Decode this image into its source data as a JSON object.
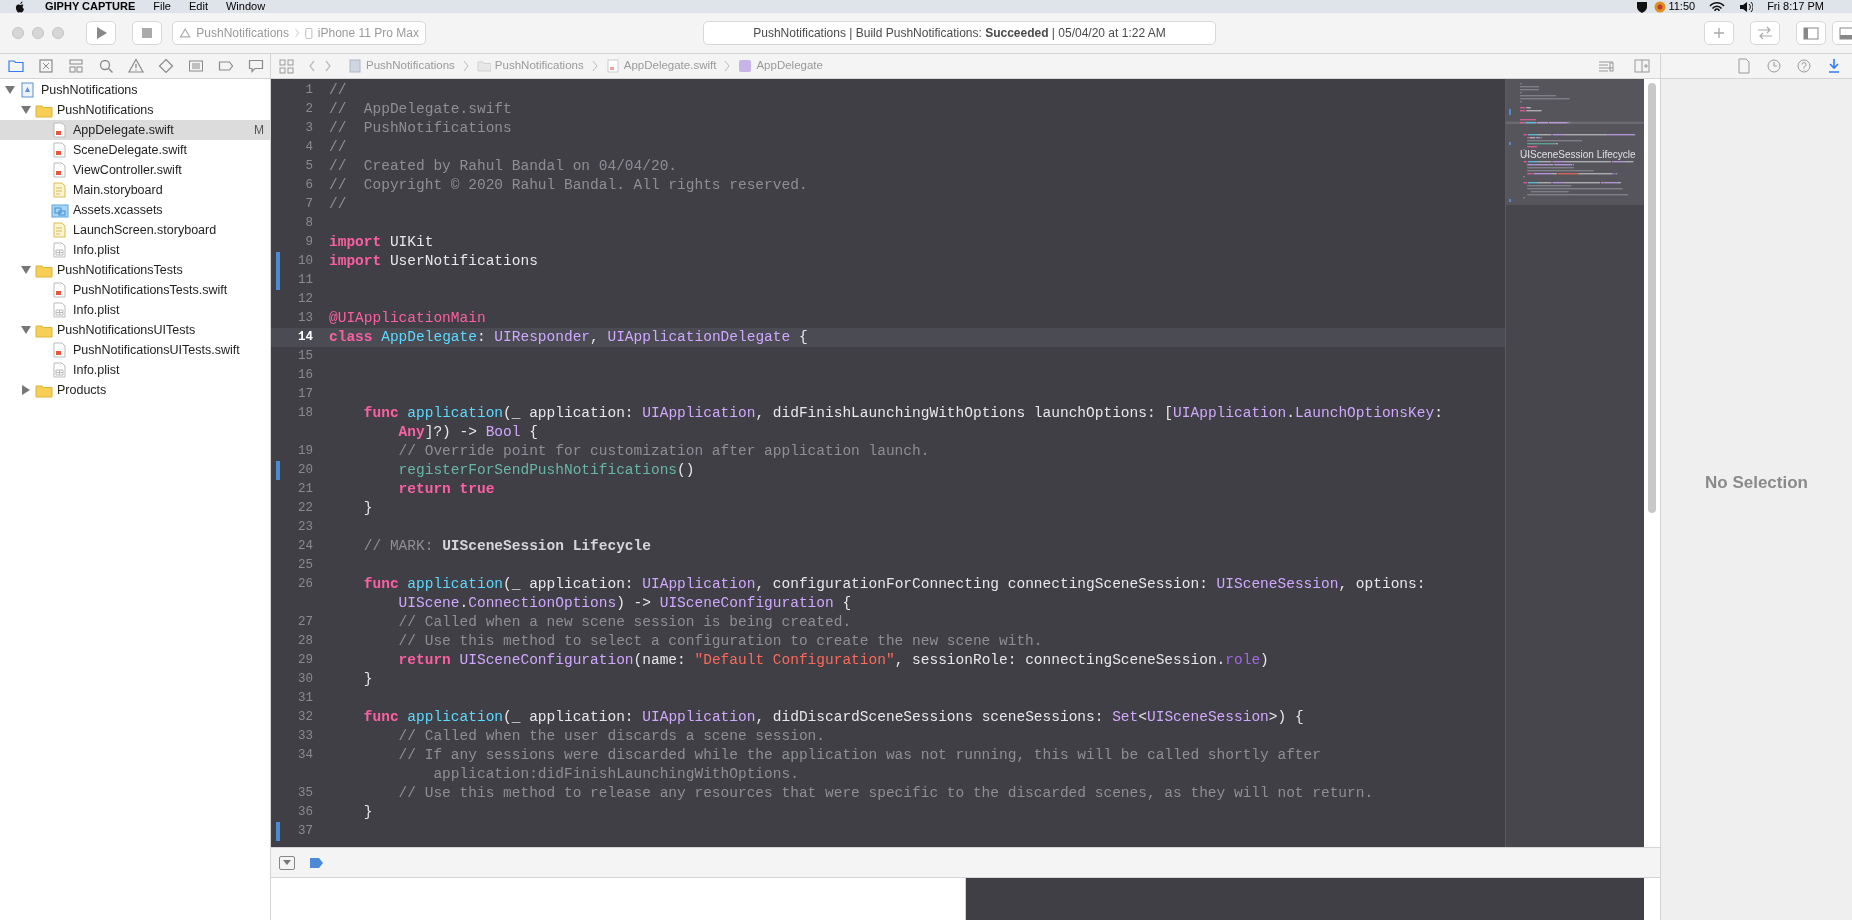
{
  "menubar": {
    "app": "GIPHY CAPTURE",
    "menus": [
      "File",
      "Edit",
      "Window"
    ],
    "status_time": "11:50",
    "datetime": "Fri 8:17 PM"
  },
  "toolbar": {
    "scheme": "PushNotifications",
    "device": "iPhone 11 Pro Max",
    "status": "PushNotifications | Build PushNotifications: **Succeeded** | 05/04/20 at 1:22 AM"
  },
  "navigator_tabs": [
    {
      "kind": "project",
      "selected": true
    },
    {
      "kind": "source_control",
      "selected": false
    },
    {
      "kind": "symbols",
      "selected": false
    },
    {
      "kind": "find",
      "selected": false
    },
    {
      "kind": "issues",
      "selected": false
    },
    {
      "kind": "tests",
      "selected": false
    },
    {
      "kind": "debug",
      "selected": false
    },
    {
      "kind": "breakpoints",
      "selected": false
    },
    {
      "kind": "reports",
      "selected": false
    }
  ],
  "jump_bar": [
    {
      "kind": "project",
      "label": "PushNotifications"
    },
    {
      "kind": "folder",
      "label": "PushNotifications"
    },
    {
      "kind": "swift",
      "label": "AppDelegate.swift"
    },
    {
      "kind": "class",
      "label": "AppDelegate"
    }
  ],
  "inspector_tabs": [
    {
      "kind": "file",
      "selected": false
    },
    {
      "kind": "history",
      "selected": false
    },
    {
      "kind": "help",
      "selected": false
    },
    {
      "kind": "attributes",
      "selected": true
    }
  ],
  "navigator": {
    "tree": [
      {
        "label": "PushNotifications",
        "kind": "project",
        "expanded": true,
        "selected": false,
        "children": [
          {
            "label": "PushNotifications",
            "kind": "folder",
            "expanded": true,
            "selected": false,
            "children": [
              {
                "label": "AppDelegate.swift",
                "kind": "swift",
                "selected": true,
                "badge": "M"
              },
              {
                "label": "SceneDelegate.swift",
                "kind": "swift",
                "selected": false
              },
              {
                "label": "ViewController.swift",
                "kind": "swift",
                "selected": false
              },
              {
                "label": "Main.storyboard",
                "kind": "storyboard",
                "selected": false
              },
              {
                "label": "Assets.xcassets",
                "kind": "assets",
                "selected": false
              },
              {
                "label": "LaunchScreen.storyboard",
                "kind": "storyboard",
                "selected": false
              },
              {
                "label": "Info.plist",
                "kind": "plist",
                "selected": false
              }
            ]
          },
          {
            "label": "PushNotificationsTests",
            "kind": "folder",
            "expanded": true,
            "selected": false,
            "children": [
              {
                "label": "PushNotificationsTests.swift",
                "kind": "swift",
                "selected": false
              },
              {
                "label": "Info.plist",
                "kind": "plist",
                "selected": false
              }
            ]
          },
          {
            "label": "PushNotificationsUITests",
            "kind": "folder",
            "expanded": true,
            "selected": false,
            "children": [
              {
                "label": "PushNotificationsUITests.swift",
                "kind": "swift",
                "selected": false
              },
              {
                "label": "Info.plist",
                "kind": "plist",
                "selected": false
              }
            ]
          },
          {
            "label": "Products",
            "kind": "folder",
            "expanded": false,
            "selected": false
          }
        ]
      }
    ]
  },
  "editor": {
    "lines": [
      {
        "number": "1",
        "current": false,
        "changed": false,
        "tokens": [
          {
            "kind": "comment",
            "text": "//"
          }
        ]
      },
      {
        "number": "2",
        "current": false,
        "changed": false,
        "tokens": [
          {
            "kind": "comment",
            "text": "//  AppDelegate.swift"
          }
        ]
      },
      {
        "number": "3",
        "current": false,
        "changed": false,
        "tokens": [
          {
            "kind": "comment",
            "text": "//  PushNotifications"
          }
        ]
      },
      {
        "number": "4",
        "current": false,
        "changed": false,
        "tokens": [
          {
            "kind": "comment",
            "text": "//"
          }
        ]
      },
      {
        "number": "5",
        "current": false,
        "changed": false,
        "tokens": [
          {
            "kind": "comment",
            "text": "//  Created by Rahul Bandal on 04/04/20."
          }
        ]
      },
      {
        "number": "6",
        "current": false,
        "changed": false,
        "tokens": [
          {
            "kind": "comment",
            "text": "//  Copyright © 2020 Rahul Bandal. All rights reserved."
          }
        ]
      },
      {
        "number": "7",
        "current": false,
        "changed": false,
        "tokens": [
          {
            "kind": "comment",
            "text": "//"
          }
        ]
      },
      {
        "number": "8",
        "current": false,
        "changed": false
      },
      {
        "number": "9",
        "current": false,
        "changed": false,
        "tokens": [
          {
            "kind": "keyword",
            "text": "import"
          },
          {
            "kind": "plain",
            "text": " UIKit"
          }
        ]
      },
      {
        "number": "10",
        "current": false,
        "changed": true,
        "tokens": [
          {
            "kind": "keyword",
            "text": "import"
          },
          {
            "kind": "plain",
            "text": " UserNotifications"
          }
        ]
      },
      {
        "number": "11",
        "current": false,
        "changed": true
      },
      {
        "number": "12",
        "current": false,
        "changed": false
      },
      {
        "number": "13",
        "current": false,
        "changed": false,
        "tokens": [
          {
            "kind": "attribute",
            "text": "@UIApplicationMain"
          }
        ]
      },
      {
        "number": "14",
        "current": true,
        "changed": false,
        "tokens": [
          {
            "kind": "keyword",
            "text": "class "
          },
          {
            "kind": "decl",
            "text": "AppDelegate"
          },
          {
            "kind": "plain",
            "text": ": "
          },
          {
            "kind": "type",
            "text": "UIResponder"
          },
          {
            "kind": "plain",
            "text": ", "
          },
          {
            "kind": "type",
            "text": "UIApplicationDelegate"
          },
          {
            "kind": "plain",
            "text": " {"
          }
        ]
      },
      {
        "number": "15",
        "current": false,
        "changed": false
      },
      {
        "number": "16",
        "current": false,
        "changed": false
      },
      {
        "number": "17",
        "current": false,
        "changed": false
      },
      {
        "number": "18",
        "current": false,
        "changed": false,
        "tokens": [
          {
            "kind": "keyword",
            "text": "    func "
          },
          {
            "kind": "decl",
            "text": "application"
          },
          {
            "kind": "plain",
            "text": "(_ application: "
          },
          {
            "kind": "type",
            "text": "UIApplication"
          },
          {
            "kind": "plain",
            "text": ", didFinishLaunchingWithOptions launchOptions: ["
          },
          {
            "kind": "type",
            "text": "UIApplication"
          },
          {
            "kind": "plain",
            "text": "."
          },
          {
            "kind": "type",
            "text": "LaunchOptionsKey"
          },
          {
            "kind": "plain",
            "text": ":"
          }
        ],
        "wrap": [
          {
            "kind": "keyword",
            "text": "        Any"
          },
          {
            "kind": "plain",
            "text": "]?) -> "
          },
          {
            "kind": "type",
            "text": "Bool"
          },
          {
            "kind": "plain",
            "text": " {"
          }
        ]
      },
      {
        "number": "19",
        "current": false,
        "changed": false,
        "tokens": [
          {
            "kind": "comment",
            "text": "        // Override point for customization after application launch."
          }
        ]
      },
      {
        "number": "20",
        "current": false,
        "changed": true,
        "tokens": [
          {
            "kind": "call",
            "text": "        registerForSendPushNotifications"
          },
          {
            "kind": "plain",
            "text": "()"
          }
        ]
      },
      {
        "number": "21",
        "current": false,
        "changed": false,
        "tokens": [
          {
            "kind": "keyword",
            "text": "        return true"
          }
        ]
      },
      {
        "number": "22",
        "current": false,
        "changed": false,
        "tokens": [
          {
            "kind": "plain",
            "text": "    }"
          }
        ]
      },
      {
        "number": "23",
        "current": false,
        "changed": false
      },
      {
        "number": "24",
        "current": false,
        "changed": false,
        "tokens": [
          {
            "kind": "comment",
            "text": "    // MARK: "
          },
          {
            "kind": "mark",
            "text": "UISceneSession Lifecycle"
          }
        ]
      },
      {
        "number": "25",
        "current": false,
        "changed": false
      },
      {
        "number": "26",
        "current": false,
        "changed": false,
        "tokens": [
          {
            "kind": "keyword",
            "text": "    func "
          },
          {
            "kind": "decl",
            "text": "application"
          },
          {
            "kind": "plain",
            "text": "(_ application: "
          },
          {
            "kind": "type",
            "text": "UIApplication"
          },
          {
            "kind": "plain",
            "text": ", configurationForConnecting connectingSceneSession: "
          },
          {
            "kind": "type",
            "text": "UISceneSession"
          },
          {
            "kind": "plain",
            "text": ", options:"
          }
        ],
        "wrap": [
          {
            "kind": "type",
            "text": "        UIScene"
          },
          {
            "kind": "plain",
            "text": "."
          },
          {
            "kind": "type",
            "text": "ConnectionOptions"
          },
          {
            "kind": "plain",
            "text": ") -> "
          },
          {
            "kind": "type",
            "text": "UISceneConfiguration"
          },
          {
            "kind": "plain",
            "text": " {"
          }
        ]
      },
      {
        "number": "27",
        "current": false,
        "changed": false,
        "tokens": [
          {
            "kind": "comment",
            "text": "        // Called when a new scene session is being created."
          }
        ]
      },
      {
        "number": "28",
        "current": false,
        "changed": false,
        "tokens": [
          {
            "kind": "comment",
            "text": "        // Use this method to select a configuration to create the new scene with."
          }
        ]
      },
      {
        "number": "29",
        "current": false,
        "changed": false,
        "tokens": [
          {
            "kind": "keyword",
            "text": "        return "
          },
          {
            "kind": "type",
            "text": "UISceneConfiguration"
          },
          {
            "kind": "plain",
            "text": "(name: "
          },
          {
            "kind": "string",
            "text": "\"Default Configuration\""
          },
          {
            "kind": "plain",
            "text": ", sessionRole: connectingSceneSession."
          },
          {
            "kind": "property",
            "text": "role"
          },
          {
            "kind": "plain",
            "text": ")"
          }
        ]
      },
      {
        "number": "30",
        "current": false,
        "changed": false,
        "tokens": [
          {
            "kind": "plain",
            "text": "    }"
          }
        ]
      },
      {
        "number": "31",
        "current": false,
        "changed": false
      },
      {
        "number": "32",
        "current": false,
        "changed": false,
        "tokens": [
          {
            "kind": "keyword",
            "text": "    func "
          },
          {
            "kind": "decl",
            "text": "application"
          },
          {
            "kind": "plain",
            "text": "(_ application: "
          },
          {
            "kind": "type",
            "text": "UIApplication"
          },
          {
            "kind": "plain",
            "text": ", didDiscardSceneSessions sceneSessions: "
          },
          {
            "kind": "type",
            "text": "Set"
          },
          {
            "kind": "plain",
            "text": "<"
          },
          {
            "kind": "type",
            "text": "UISceneSession"
          },
          {
            "kind": "plain",
            "text": ">) {"
          }
        ]
      },
      {
        "number": "33",
        "current": false,
        "changed": false,
        "tokens": [
          {
            "kind": "comment",
            "text": "        // Called when the user discards a scene session."
          }
        ]
      },
      {
        "number": "34",
        "current": false,
        "changed": false,
        "tokens": [
          {
            "kind": "comment",
            "text": "        // If any sessions were discarded while the application was not running, this will be called shortly after"
          }
        ],
        "wrap": [
          {
            "kind": "comment",
            "text": "            application:didFinishLaunchingWithOptions."
          }
        ]
      },
      {
        "number": "35",
        "current": false,
        "changed": false,
        "tokens": [
          {
            "kind": "comment",
            "text": "        // Use this method to release any resources that were specific to the discarded scenes, as they will not return."
          }
        ]
      },
      {
        "number": "36",
        "current": false,
        "changed": false,
        "tokens": [
          {
            "kind": "plain",
            "text": "    }"
          }
        ]
      },
      {
        "number": "37",
        "current": false,
        "changed": true
      }
    ]
  },
  "minimap": {
    "mark_label": "UISceneSession Lifecycle"
  },
  "inspector": {
    "empty_text": "No Selection"
  }
}
